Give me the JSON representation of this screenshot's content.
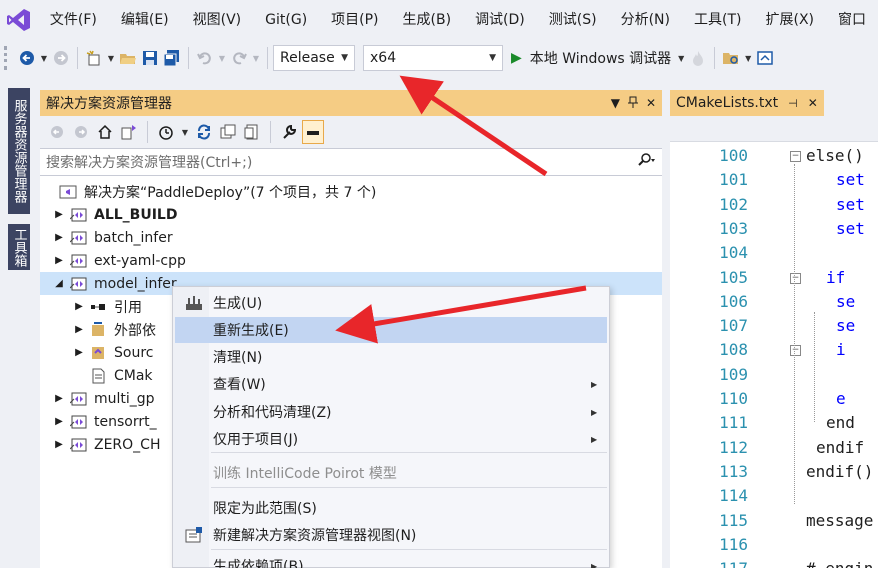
{
  "menubar": {
    "logo": "visual-studio-logo",
    "items": [
      "文件(F)",
      "编辑(E)",
      "视图(V)",
      "Git(G)",
      "项目(P)",
      "生成(B)",
      "调试(D)",
      "测试(S)",
      "分析(N)",
      "工具(T)",
      "扩展(X)",
      "窗口"
    ]
  },
  "toolbar": {
    "configuration": "Release",
    "platform": "x64",
    "debug_target": "本地 Windows 调试器"
  },
  "rail": {
    "tab1": "服务器资源管理器",
    "tab2": "工具箱"
  },
  "solution_explorer": {
    "title": "解决方案资源管理器",
    "search_placeholder": "搜索解决方案资源管理器(Ctrl+;)",
    "solution_label": "解决方案“PaddleDeploy”(7 个项目，共 7 个)",
    "projects": [
      {
        "name": "ALL_BUILD",
        "bold": true
      },
      {
        "name": "batch_infer"
      },
      {
        "name": "ext-yaml-cpp"
      },
      {
        "name": "model_infer",
        "expanded": true,
        "selected": true
      },
      {
        "name": "引用",
        "child": true
      },
      {
        "name": "外部依",
        "child": true
      },
      {
        "name": "Sourc",
        "child": true
      },
      {
        "name": "CMak",
        "child": true
      },
      {
        "name": "multi_gp"
      },
      {
        "name": "tensorrt_"
      },
      {
        "name": "ZERO_CH"
      }
    ]
  },
  "editor": {
    "tab_label": "CMakeLists.txt",
    "lines": [
      {
        "n": "100",
        "text": "else()"
      },
      {
        "n": "101",
        "text": "set"
      },
      {
        "n": "102",
        "text": "set"
      },
      {
        "n": "103",
        "text": "set"
      },
      {
        "n": "104",
        "text": ""
      },
      {
        "n": "105",
        "text": "if"
      },
      {
        "n": "106",
        "text": "se"
      },
      {
        "n": "107",
        "text": "se"
      },
      {
        "n": "108",
        "text": "i"
      },
      {
        "n": "109",
        "text": ""
      },
      {
        "n": "110",
        "text": "e"
      },
      {
        "n": "111",
        "text": "end"
      },
      {
        "n": "112",
        "text": "endif"
      },
      {
        "n": "113",
        "text": "endif()"
      },
      {
        "n": "114",
        "text": ""
      },
      {
        "n": "115",
        "text": "message"
      },
      {
        "n": "116",
        "text": ""
      },
      {
        "n": "117",
        "text": "# engin"
      }
    ]
  },
  "context_menu": {
    "items": [
      {
        "label": "生成(U)",
        "icon": "build-icon"
      },
      {
        "label": "重新生成(E)",
        "hover": true
      },
      {
        "label": "清理(N)"
      },
      {
        "label": "查看(W)",
        "submenu": true
      },
      {
        "label": "分析和代码清理(Z)",
        "submenu": true
      },
      {
        "label": "仅用于项目(J)",
        "submenu": true
      },
      {
        "label": "训练 IntelliCode Poirot 模型",
        "disabled": true
      },
      {
        "label": "限定为此范围(S)"
      },
      {
        "label": "新建解决方案资源管理器视图(N)",
        "icon": "new-view-icon"
      },
      {
        "label": "生成依赖项(B)",
        "submenu": true
      }
    ]
  },
  "colors": {
    "accent_tab": "#f5cc84",
    "selection": "#cce3fa",
    "menu_hover": "#c2d5f2",
    "annotation_arrow": "#e8262a"
  }
}
